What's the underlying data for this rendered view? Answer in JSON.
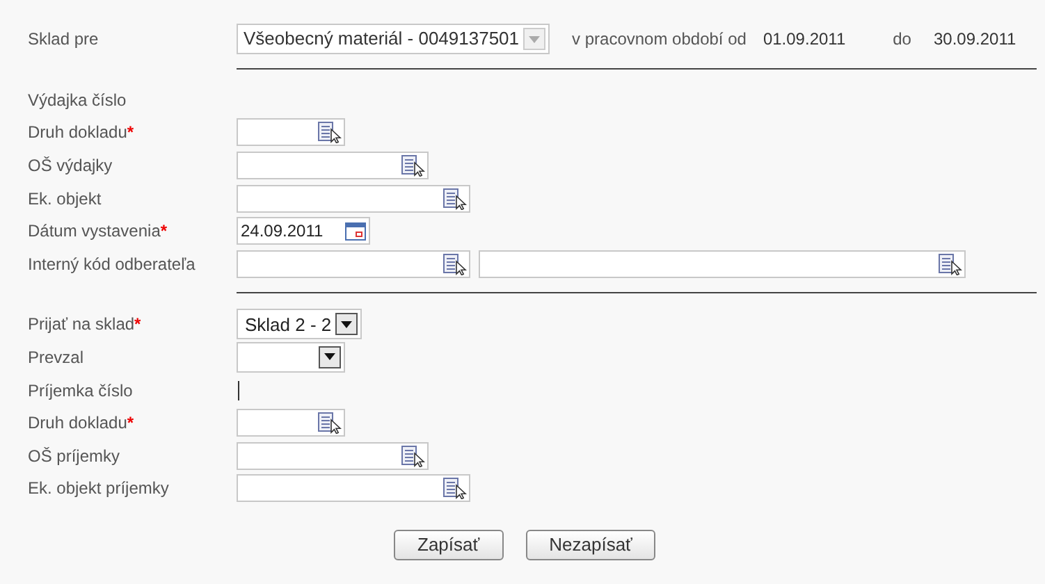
{
  "header": {
    "label": "Sklad pre",
    "warehouse": {
      "value": "Všeobecný materiál - 0049137501",
      "disabled": true
    },
    "period_label": "v pracovnom období od",
    "from": "01.09.2011",
    "to_label": "do",
    "to": "30.09.2011"
  },
  "issue_section": {
    "rows": [
      {
        "label": "Výdajka číslo",
        "kind": "text"
      },
      {
        "label": "Druh dokladu",
        "required_mark": "*",
        "kind": "lookup"
      },
      {
        "label": "OŠ výdajky",
        "kind": "lookup"
      },
      {
        "label": "Ek. objekt",
        "kind": "lookup"
      },
      {
        "label": "Dátum vystavenia",
        "required_mark": "*",
        "kind": "date",
        "value": "24.09.2011"
      },
      {
        "label": "Interný kód odberateľa",
        "kind": "lookup_pair"
      }
    ]
  },
  "receipt_section": {
    "rows": [
      {
        "label": "Prijať na sklad",
        "required_mark": "*",
        "kind": "select",
        "value": "Sklad 2 - 2"
      },
      {
        "label": "Prevzal",
        "kind": "select"
      },
      {
        "label": "Príjemka číslo",
        "kind": "caret"
      },
      {
        "label": "Druh dokladu",
        "required_mark": "*",
        "kind": "lookup"
      },
      {
        "label": "OŠ príjemky",
        "kind": "lookup"
      },
      {
        "label": "Ek. objekt príjemky",
        "kind": "lookup"
      }
    ]
  },
  "buttons": [
    {
      "label": "Zapísať"
    },
    {
      "label": "Nezapísať"
    }
  ]
}
